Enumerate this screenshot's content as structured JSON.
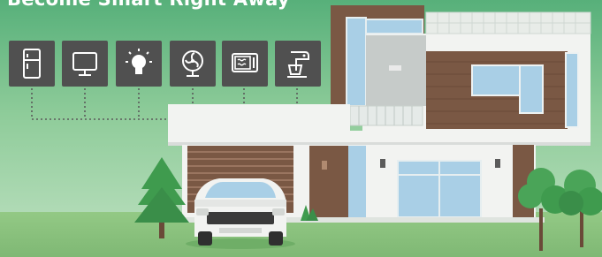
{
  "headline": "Become Smart Right Away",
  "colors": {
    "sky_top": "#cfe7d5",
    "sky_bottom": "#9fd3a6",
    "grass": "#8cc57c",
    "house_white": "#f2f3f1",
    "wood": "#7a5844",
    "glass": "#a9cfe6",
    "tile": "#505050",
    "tree": "#3f9b4e"
  },
  "appliances": [
    {
      "name": "refrigerator",
      "icon": "refrigerator-icon"
    },
    {
      "name": "monitor",
      "icon": "monitor-icon"
    },
    {
      "name": "light-bulb",
      "icon": "light-bulb-icon"
    },
    {
      "name": "fan",
      "icon": "fan-icon"
    },
    {
      "name": "microwave",
      "icon": "microwave-icon"
    },
    {
      "name": "mixer",
      "icon": "mixer-icon"
    }
  ]
}
